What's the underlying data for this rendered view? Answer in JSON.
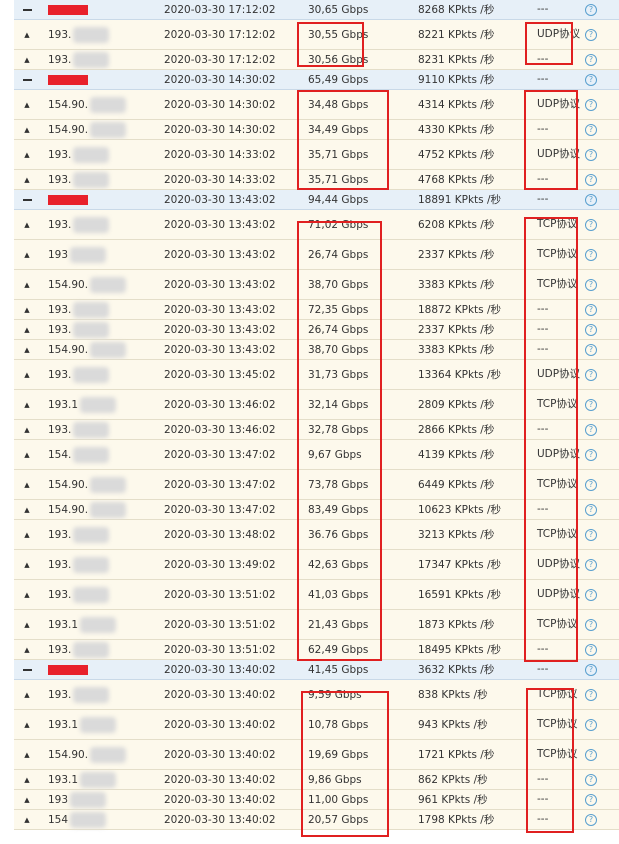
{
  "table": {
    "rows": [
      {
        "type": "group",
        "ip": "",
        "time": "2020-03-30 17:12:02",
        "rate": "30,65 Gbps",
        "pkts": "8268 KPkts /秒",
        "proto": "---"
      },
      {
        "type": "child",
        "ip": "193.",
        "time": "2020-03-30 17:12:02",
        "rate": "30,55 Gbps",
        "pkts": "8221 KPkts /秒",
        "proto": "UDP协议"
      },
      {
        "type": "child",
        "ip": "193.",
        "time": "2020-03-30 17:12:02",
        "rate": "30,56 Gbps",
        "pkts": "8231 KPkts /秒",
        "proto": "---"
      },
      {
        "type": "group",
        "ip": "",
        "time": "2020-03-30 14:30:02",
        "rate": "65,49 Gbps",
        "pkts": "9110 KPkts /秒",
        "proto": "---"
      },
      {
        "type": "child",
        "ip": "154.90.",
        "time": "2020-03-30 14:30:02",
        "rate": "34,48 Gbps",
        "pkts": "4314 KPkts /秒",
        "proto": "UDP协议"
      },
      {
        "type": "child",
        "ip": "154.90.",
        "time": "2020-03-30 14:30:02",
        "rate": "34,49 Gbps",
        "pkts": "4330 KPkts /秒",
        "proto": "---"
      },
      {
        "type": "child",
        "ip": "193.",
        "time": "2020-03-30 14:33:02",
        "rate": "35,71 Gbps",
        "pkts": "4752 KPkts /秒",
        "proto": "UDP协议"
      },
      {
        "type": "child",
        "ip": "193.",
        "time": "2020-03-30 14:33:02",
        "rate": "35,71 Gbps",
        "pkts": "4768 KPkts /秒",
        "proto": "---"
      },
      {
        "type": "group",
        "ip": "",
        "time": "2020-03-30 13:43:02",
        "rate": "94,44 Gbps",
        "pkts": "18891 KPkts /秒",
        "proto": "---"
      },
      {
        "type": "child",
        "ip": "193.",
        "time": "2020-03-30 13:43:02",
        "rate": "71,02 Gbps",
        "pkts": "6208 KPkts /秒",
        "proto": "TCP协议"
      },
      {
        "type": "child",
        "ip": "193",
        "time": "2020-03-30 13:43:02",
        "rate": "26,74 Gbps",
        "pkts": "2337 KPkts /秒",
        "proto": "TCP协议"
      },
      {
        "type": "child",
        "ip": "154.90.",
        "time": "2020-03-30 13:43:02",
        "rate": "38,70 Gbps",
        "pkts": "3383 KPkts /秒",
        "proto": "TCP协议"
      },
      {
        "type": "child",
        "ip": "193.",
        "time": "2020-03-30 13:43:02",
        "rate": "72,35 Gbps",
        "pkts": "18872 KPkts /秒",
        "proto": "---"
      },
      {
        "type": "child",
        "ip": "193.",
        "time": "2020-03-30 13:43:02",
        "rate": "26,74 Gbps",
        "pkts": "2337 KPkts /秒",
        "proto": "---"
      },
      {
        "type": "child",
        "ip": "154.90.",
        "time": "2020-03-30 13:43:02",
        "rate": "38,70 Gbps",
        "pkts": "3383 KPkts /秒",
        "proto": "---"
      },
      {
        "type": "child",
        "ip": "193.",
        "time": "2020-03-30 13:45:02",
        "rate": "31,73 Gbps",
        "pkts": "13364 KPkts /秒",
        "proto": "UDP协议"
      },
      {
        "type": "child",
        "ip": "193.1",
        "time": "2020-03-30 13:46:02",
        "rate": "32,14 Gbps",
        "pkts": "2809 KPkts /秒",
        "proto": "TCP协议"
      },
      {
        "type": "child",
        "ip": "193.",
        "time": "2020-03-30 13:46:02",
        "rate": "32,78 Gbps",
        "pkts": "2866 KPkts /秒",
        "proto": "---"
      },
      {
        "type": "child",
        "ip": "154.",
        "time": "2020-03-30 13:47:02",
        "rate": "9,67 Gbps",
        "pkts": "4139 KPkts /秒",
        "proto": "UDP协议"
      },
      {
        "type": "child",
        "ip": "154.90.",
        "time": "2020-03-30 13:47:02",
        "rate": "73,78 Gbps",
        "pkts": "6449 KPkts /秒",
        "proto": "TCP协议"
      },
      {
        "type": "child",
        "ip": "154.90.",
        "time": "2020-03-30 13:47:02",
        "rate": "83,49 Gbps",
        "pkts": "10623 KPkts /秒",
        "proto": "---"
      },
      {
        "type": "child",
        "ip": "193.",
        "time": "2020-03-30 13:48:02",
        "rate": "36.76 Gbps",
        "pkts": "3213 KPkts /秒",
        "proto": "TCP协议"
      },
      {
        "type": "child",
        "ip": "193.",
        "time": "2020-03-30 13:49:02",
        "rate": "42,63 Gbps",
        "pkts": "17347 KPkts /秒",
        "proto": "UDP协议"
      },
      {
        "type": "child",
        "ip": "193.",
        "time": "2020-03-30 13:51:02",
        "rate": "41,03 Gbps",
        "pkts": "16591 KPkts /秒",
        "proto": "UDP协议"
      },
      {
        "type": "child",
        "ip": "193.1",
        "time": "2020-03-30 13:51:02",
        "rate": "21,43 Gbps",
        "pkts": "1873 KPkts /秒",
        "proto": "TCP协议"
      },
      {
        "type": "child",
        "ip": "193.",
        "time": "2020-03-30 13:51:02",
        "rate": "62,49 Gbps",
        "pkts": "18495 KPkts /秒",
        "proto": "---"
      },
      {
        "type": "group",
        "ip": "",
        "time": "2020-03-30 13:40:02",
        "rate": "41,45 Gbps",
        "pkts": "3632 KPkts /秒",
        "proto": "---"
      },
      {
        "type": "child",
        "ip": "193.",
        "time": "2020-03-30 13:40:02",
        "rate": "9,59 Gbps",
        "pkts": "838 KPkts /秒",
        "proto": "TCP协议"
      },
      {
        "type": "child",
        "ip": "193.1",
        "time": "2020-03-30 13:40:02",
        "rate": "10,78 Gbps",
        "pkts": "943 KPkts /秒",
        "proto": "TCP协议"
      },
      {
        "type": "child",
        "ip": "154.90.",
        "time": "2020-03-30 13:40:02",
        "rate": "19,69 Gbps",
        "pkts": "1721 KPkts /秒",
        "proto": "TCP协议"
      },
      {
        "type": "child",
        "ip": "193.1",
        "time": "2020-03-30 13:40:02",
        "rate": "9,86 Gbps",
        "pkts": "862 KPkts /秒",
        "proto": "---"
      },
      {
        "type": "child",
        "ip": "193",
        "time": "2020-03-30 13:40:02",
        "rate": "11,00 Gbps",
        "pkts": "961 KPkts /秒",
        "proto": "---"
      },
      {
        "type": "child",
        "ip": "154",
        "time": "2020-03-30 13:40:02",
        "rate": "20,57 Gbps",
        "pkts": "1798 KPkts /秒",
        "proto": "---"
      }
    ]
  },
  "colors": {
    "highlight": "#e02020",
    "redaction": "#e8212b",
    "group_bg": "#e7f0f8",
    "child_bg": "#fdf9ec",
    "help": "#5aa0cf"
  },
  "icons": {
    "collapse": "minus-icon",
    "expand": "triangle-up-icon",
    "help": "question-mark-icon"
  }
}
